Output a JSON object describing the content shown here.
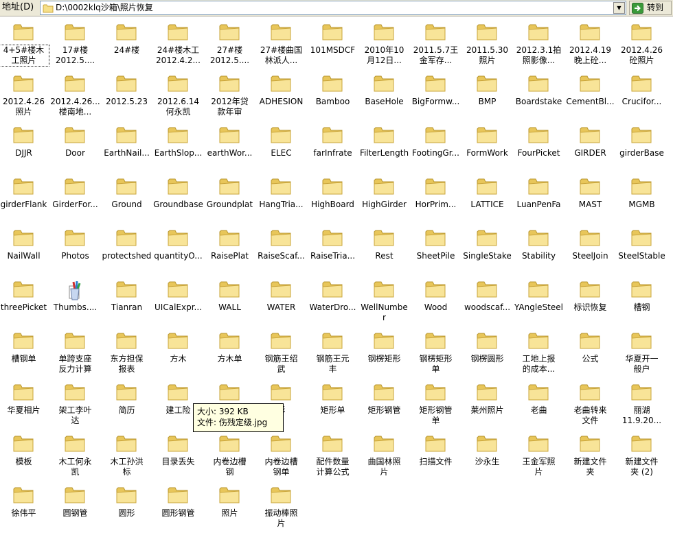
{
  "address_bar": {
    "label": "地址(D)",
    "path": "D:\\0002klq沙箱\\照片恢复",
    "go_label": "转到"
  },
  "colors": {
    "folder_fill": "#f6e08a",
    "folder_stroke": "#c9a43a",
    "tooltip_bg": "#ffffe1"
  },
  "items": [
    {
      "label": "4+5#楼木\n工照片",
      "icon": "folder-icon"
    },
    {
      "label": "17#楼\n2012.5....",
      "icon": "folder-icon"
    },
    {
      "label": "24#楼",
      "icon": "folder-icon"
    },
    {
      "label": "24#楼木工\n2012.4.2...",
      "icon": "folder-icon"
    },
    {
      "label": "27#楼\n2012.5....",
      "icon": "folder-icon"
    },
    {
      "label": "27#楼曲国\n林派人...",
      "icon": "folder-icon"
    },
    {
      "label": "101MSDCF",
      "icon": "folder-icon"
    },
    {
      "label": "2010年10\n月12日...",
      "icon": "folder-icon"
    },
    {
      "label": "2011.5.7王\n金军存...",
      "icon": "folder-icon"
    },
    {
      "label": "2011.5.30\n照片",
      "icon": "folder-icon"
    },
    {
      "label": "2012.3.1拍\n照影像...",
      "icon": "folder-icon"
    },
    {
      "label": "2012.4.19\n晚上砼...",
      "icon": "folder-icon"
    },
    {
      "label": "2012.4.26\n砼照片",
      "icon": "folder-icon"
    },
    {
      "label": "2012.4.26\n照片",
      "icon": "folder-icon"
    },
    {
      "label": "2012.4.26...\n楼南地...",
      "icon": "folder-icon"
    },
    {
      "label": "2012.5.23",
      "icon": "folder-icon"
    },
    {
      "label": "2012.6.14\n何永凯",
      "icon": "folder-icon"
    },
    {
      "label": "2012年贷\n款年审",
      "icon": "folder-icon"
    },
    {
      "label": "ADHESION",
      "icon": "folder-icon"
    },
    {
      "label": "Bamboo",
      "icon": "folder-icon"
    },
    {
      "label": "BaseHole",
      "icon": "folder-icon"
    },
    {
      "label": "BigFormw...",
      "icon": "folder-icon"
    },
    {
      "label": "BMP",
      "icon": "folder-icon"
    },
    {
      "label": "Boardstake",
      "icon": "folder-icon"
    },
    {
      "label": "CementBl...",
      "icon": "folder-icon"
    },
    {
      "label": "Crucifor...",
      "icon": "folder-icon"
    },
    {
      "label": "DJJR",
      "icon": "folder-icon"
    },
    {
      "label": "Door",
      "icon": "folder-icon"
    },
    {
      "label": "EarthNail...",
      "icon": "folder-icon"
    },
    {
      "label": "EarthSlop...",
      "icon": "folder-icon"
    },
    {
      "label": "earthWor...",
      "icon": "folder-icon"
    },
    {
      "label": "ELEC",
      "icon": "folder-icon"
    },
    {
      "label": "farInfrate",
      "icon": "folder-icon"
    },
    {
      "label": "FilterLength",
      "icon": "folder-icon"
    },
    {
      "label": "FootingGr...",
      "icon": "folder-icon"
    },
    {
      "label": "FormWork",
      "icon": "folder-icon"
    },
    {
      "label": "FourPicket",
      "icon": "folder-icon"
    },
    {
      "label": "GIRDER",
      "icon": "folder-icon"
    },
    {
      "label": "girderBase",
      "icon": "folder-icon"
    },
    {
      "label": "girderFlank",
      "icon": "folder-icon"
    },
    {
      "label": "GirderFor...",
      "icon": "folder-icon"
    },
    {
      "label": "Ground",
      "icon": "folder-icon"
    },
    {
      "label": "Groundbase",
      "icon": "folder-icon"
    },
    {
      "label": "Groundplat",
      "icon": "folder-icon"
    },
    {
      "label": "HangTria...",
      "icon": "folder-icon"
    },
    {
      "label": "HighBoard",
      "icon": "folder-icon"
    },
    {
      "label": "HighGirder",
      "icon": "folder-icon"
    },
    {
      "label": "HorPrim...",
      "icon": "folder-icon"
    },
    {
      "label": "LATTICE",
      "icon": "folder-icon"
    },
    {
      "label": "LuanPenFa",
      "icon": "folder-icon"
    },
    {
      "label": "MAST",
      "icon": "folder-icon"
    },
    {
      "label": "MGMB",
      "icon": "folder-icon"
    },
    {
      "label": "NailWall",
      "icon": "folder-icon"
    },
    {
      "label": "Photos",
      "icon": "folder-icon"
    },
    {
      "label": "protectshed",
      "icon": "folder-icon"
    },
    {
      "label": "quantityO...",
      "icon": "folder-icon"
    },
    {
      "label": "RaisePlat",
      "icon": "folder-icon"
    },
    {
      "label": "RaiseScaf...",
      "icon": "folder-icon"
    },
    {
      "label": "RaiseTria...",
      "icon": "folder-icon"
    },
    {
      "label": "Rest",
      "icon": "folder-icon"
    },
    {
      "label": "SheetPile",
      "icon": "folder-icon"
    },
    {
      "label": "SingleStake",
      "icon": "folder-icon"
    },
    {
      "label": "Stability",
      "icon": "folder-icon"
    },
    {
      "label": "SteelJoin",
      "icon": "folder-icon"
    },
    {
      "label": "SteelStable",
      "icon": "folder-icon"
    },
    {
      "label": "threePicket",
      "icon": "folder-icon"
    },
    {
      "label": "Thumbs....",
      "icon": "thumbs-db-icon"
    },
    {
      "label": "Tianran",
      "icon": "folder-icon"
    },
    {
      "label": "UICalExpr...",
      "icon": "folder-icon"
    },
    {
      "label": "WALL",
      "icon": "folder-icon"
    },
    {
      "label": "WATER",
      "icon": "folder-icon"
    },
    {
      "label": "WaterDro...",
      "icon": "folder-icon"
    },
    {
      "label": "WellNumber",
      "icon": "folder-icon"
    },
    {
      "label": "Wood",
      "icon": "folder-icon"
    },
    {
      "label": "woodscaf...",
      "icon": "folder-icon"
    },
    {
      "label": "YAngleSteel",
      "icon": "folder-icon"
    },
    {
      "label": "标识恢复",
      "icon": "folder-icon"
    },
    {
      "label": "槽钢",
      "icon": "folder-icon"
    },
    {
      "label": "槽钢单",
      "icon": "folder-icon"
    },
    {
      "label": "单跨支座\n反力计算",
      "icon": "folder-icon"
    },
    {
      "label": "东方担保\n报表",
      "icon": "folder-icon"
    },
    {
      "label": "方木",
      "icon": "folder-icon"
    },
    {
      "label": "方木单",
      "icon": "folder-icon"
    },
    {
      "label": "钢筋王绍\n武",
      "icon": "folder-icon"
    },
    {
      "label": "钢筋王元\n丰",
      "icon": "folder-icon"
    },
    {
      "label": "钢楞矩形",
      "icon": "folder-icon"
    },
    {
      "label": "钢楞矩形\n单",
      "icon": "folder-icon"
    },
    {
      "label": "钢楞圆形",
      "icon": "folder-icon"
    },
    {
      "label": "工地上报\n的成本...",
      "icon": "folder-icon"
    },
    {
      "label": "公式",
      "icon": "folder-icon"
    },
    {
      "label": "华夏开一\n般户",
      "icon": "folder-icon"
    },
    {
      "label": "华夏相片",
      "icon": "folder-icon"
    },
    {
      "label": "架工李叶\n达",
      "icon": "folder-icon"
    },
    {
      "label": "简历",
      "icon": "folder-icon"
    },
    {
      "label": "建工险",
      "icon": "folder-icon"
    },
    {
      "label": "",
      "icon": "folder-icon"
    },
    {
      "label": "形",
      "icon": "folder-icon"
    },
    {
      "label": "矩形单",
      "icon": "folder-icon"
    },
    {
      "label": "矩形钢管",
      "icon": "folder-icon"
    },
    {
      "label": "矩形钢管\n单",
      "icon": "folder-icon"
    },
    {
      "label": "莱州照片",
      "icon": "folder-icon"
    },
    {
      "label": "老曲",
      "icon": "folder-icon"
    },
    {
      "label": "老曲转来\n文件",
      "icon": "folder-icon"
    },
    {
      "label": "丽湖\n11.9.20...",
      "icon": "folder-icon"
    },
    {
      "label": "模板",
      "icon": "folder-icon"
    },
    {
      "label": "木工何永\n凯",
      "icon": "folder-icon"
    },
    {
      "label": "木工孙洪\n标",
      "icon": "folder-icon"
    },
    {
      "label": "目录丢失",
      "icon": "folder-icon"
    },
    {
      "label": "内卷边槽\n钢",
      "icon": "folder-icon"
    },
    {
      "label": "内卷边槽\n钢单",
      "icon": "folder-icon"
    },
    {
      "label": "配件数量\n计算公式",
      "icon": "folder-icon"
    },
    {
      "label": "曲国林照\n片",
      "icon": "folder-icon"
    },
    {
      "label": "扫描文件",
      "icon": "folder-icon"
    },
    {
      "label": "沙永生",
      "icon": "folder-icon"
    },
    {
      "label": "王金军照\n片",
      "icon": "folder-icon"
    },
    {
      "label": "新建文件\n夹",
      "icon": "folder-icon"
    },
    {
      "label": "新建文件\n夹 (2)",
      "icon": "folder-icon"
    },
    {
      "label": "徐伟平",
      "icon": "folder-icon"
    },
    {
      "label": "圆钢管",
      "icon": "folder-icon"
    },
    {
      "label": "圆形",
      "icon": "folder-icon"
    },
    {
      "label": "圆形钢管",
      "icon": "folder-icon"
    },
    {
      "label": "照片",
      "icon": "folder-icon"
    },
    {
      "label": "振动棒照\n片",
      "icon": "folder-icon"
    }
  ],
  "tooltip": {
    "size_line": "大小: 392 KB",
    "file_line": "文件: 伤残定级.jpg"
  }
}
